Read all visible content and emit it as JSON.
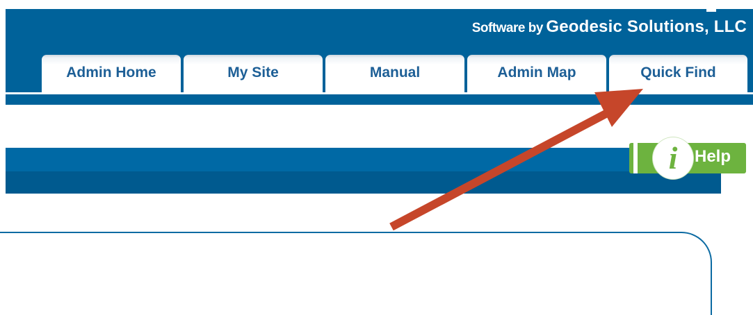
{
  "header": {
    "credit_prefix": "Software by",
    "credit_brand": "Geodesic Solutions, LLC"
  },
  "nav": {
    "tabs": [
      {
        "label": "Admin Home"
      },
      {
        "label": "My Site"
      },
      {
        "label": "Manual"
      },
      {
        "label": "Admin Map"
      },
      {
        "label": "Quick Find"
      }
    ]
  },
  "help": {
    "label": "Help",
    "icon_glyph": "i",
    "icon": "info-icon"
  },
  "annotation": {
    "arrow_color": "#c6462a",
    "points_to": "Quick Find"
  },
  "colors": {
    "header_blue": "#00629a",
    "tab_text": "#1d5f96",
    "help_green": "#6db33f"
  }
}
